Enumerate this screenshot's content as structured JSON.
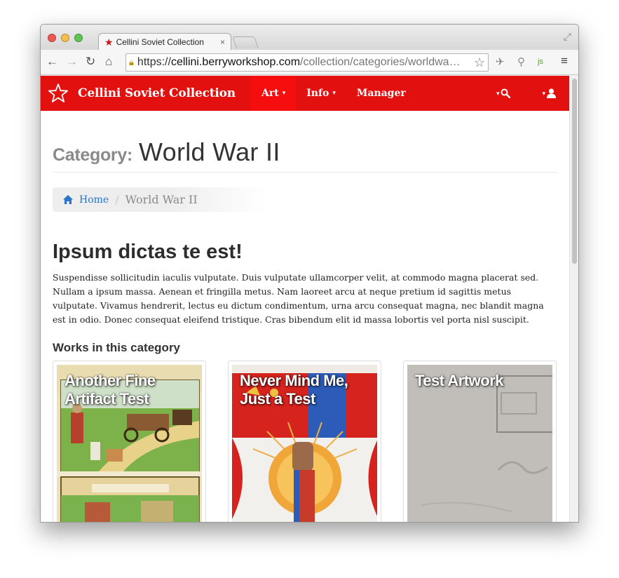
{
  "browser": {
    "tab_title": "Cellini Soviet Collection",
    "tab_close": "×",
    "url_scheme": "https://",
    "url_host": "cellini.berryworkshop.com",
    "url_path": "/collection/categories/worldwa…",
    "icons": [
      "back-arrow",
      "forward-arrow",
      "reload",
      "home",
      "lock",
      "bookmark-star",
      "pin",
      "wrench",
      "js-extension",
      "menu"
    ]
  },
  "navbar": {
    "brand": "Cellini Soviet Collection",
    "items": [
      {
        "label": "Art",
        "caret": "▾",
        "active": true
      },
      {
        "label": "Info",
        "caret": "▾",
        "active": false
      },
      {
        "label": "Manager",
        "active": false
      }
    ],
    "color": "#e2100f",
    "active_color": "#f60d0d"
  },
  "page": {
    "label": "Category:",
    "title": "World War II"
  },
  "breadcrumb": {
    "home": "Home",
    "separator": "/",
    "current": "World War II"
  },
  "lead": {
    "title": "Ipsum dictas te est!",
    "text": "Suspendisse sollicitudin iaculis vulputate. Duis vulputate ullamcorper velit, at commodo magna placerat sed. Nullam a ipsum massa. Aenean et fringilla metus. Nam laoreet arcu at neque pretium id sagittis metus vulputate. Vivamus hendrerit, lectus eu dictum condimentum, urna arcu consequat magna, nec blandit magna est in odio. Donec consequat eleifend tristique. Cras bibendum elit id massa lobortis vel porta nisl suscipit."
  },
  "works": {
    "title": "Works in this category",
    "cards": [
      {
        "title": "Another Fine Artifact Test"
      },
      {
        "title": "Never Mind Me, Just a Test"
      },
      {
        "title": "Test Artwork"
      }
    ]
  }
}
